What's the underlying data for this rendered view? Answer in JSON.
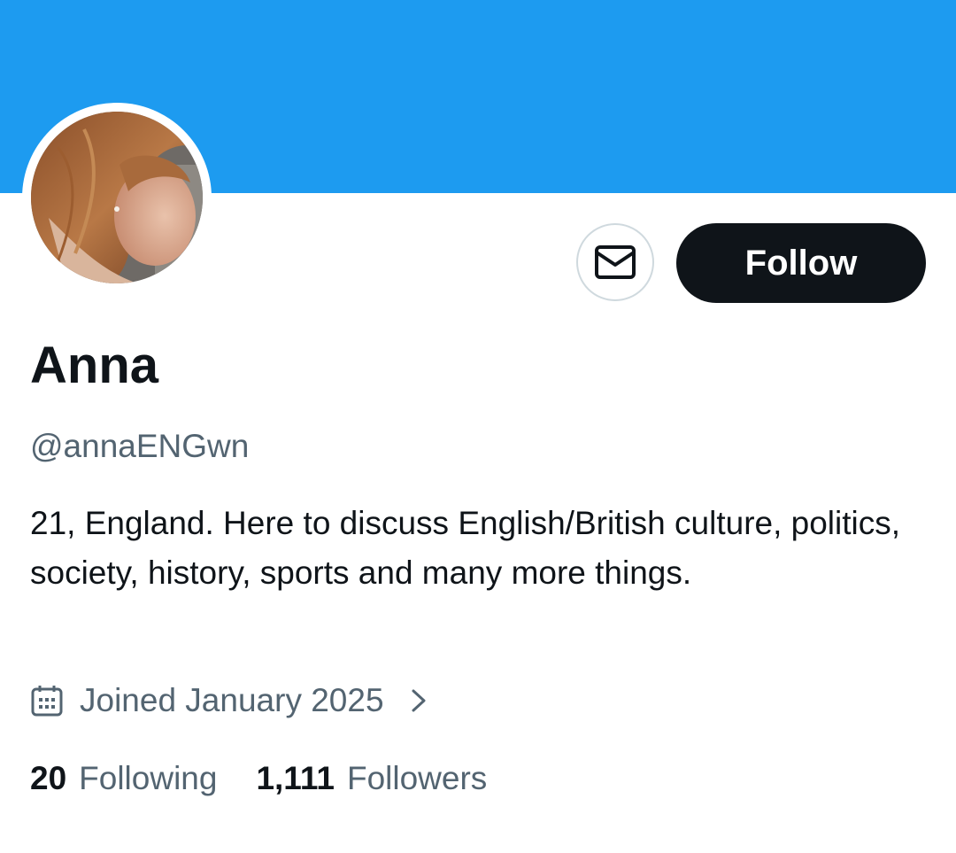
{
  "banner": {
    "color": "#1d9bf0"
  },
  "avatar": {
    "icon": "profile-photo"
  },
  "actions": {
    "message_icon": "envelope-icon",
    "follow_label": "Follow"
  },
  "profile": {
    "name": "Anna",
    "handle": "@annaENGwn",
    "bio": "21, England. Here to discuss English/British culture, politics, society, history, sports and many more things.",
    "joined": "Joined January 2025"
  },
  "stats": {
    "following_count": "20",
    "following_label": "Following",
    "followers_count": "1,111",
    "followers_label": "Followers"
  },
  "colors": {
    "accent": "#1d9bf0",
    "text": "#0f1419",
    "secondary_text": "#536471",
    "button_dark": "#0f1419"
  }
}
